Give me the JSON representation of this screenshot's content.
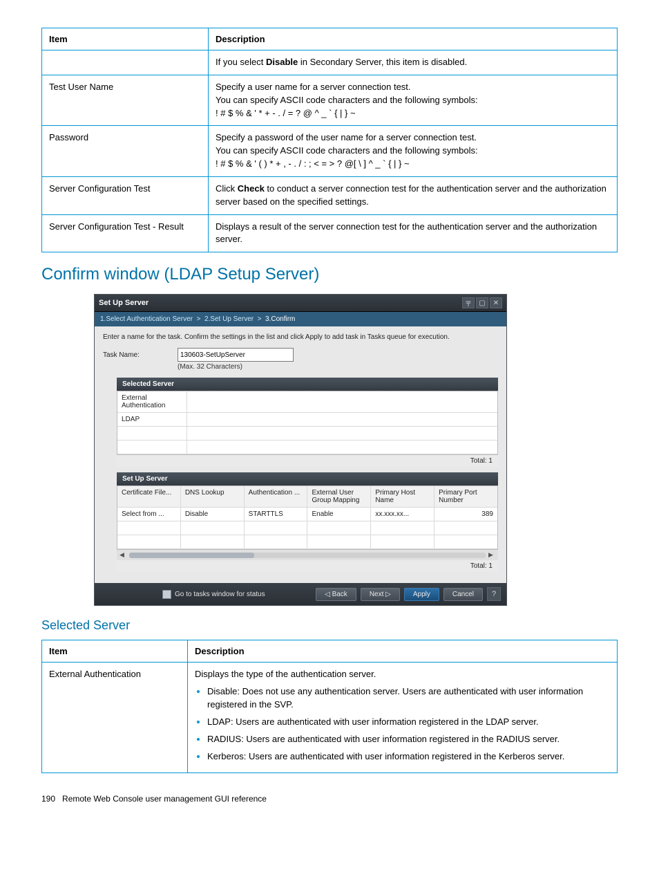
{
  "table1": {
    "headers": [
      "Item",
      "Description"
    ],
    "rows": [
      {
        "item": "",
        "desc_html": "If you select <b>Disable</b> in Secondary Server, this item is disabled."
      },
      {
        "item": "Test User Name",
        "desc_html": "Specify a user name for a server connection test.<br>You can specify ASCII code characters and the following symbols:<br>! # $ % & ' * + - . / = ? @ ^ _ ` { | } ~"
      },
      {
        "item": "Password",
        "desc_html": "Specify a password of the user name for a server connection test.<br>You can specify ASCII code characters and the following symbols:<br>! # $ % & ' ( ) * + , - . / : ; < = > ? @[ \\ ] ^ _ ` { | } ~"
      },
      {
        "item": "Server Configuration Test",
        "desc_html": "Click <b>Check</b> to conduct a server connection test for the authentication server and the authorization server based on the specified settings."
      },
      {
        "item": "Server Configuration Test - Result",
        "desc_html": "Displays a result of the server connection test for the authentication server and the authorization server."
      }
    ]
  },
  "heading_confirm": "Confirm window (LDAP Setup Server)",
  "dialog": {
    "title": "Set Up Server",
    "steps": {
      "s1": "1.Select Authentication Server",
      "s2": "2.Set Up Server",
      "s3": "3.Confirm"
    },
    "instruction": "Enter a name for the task. Confirm the settings in the list and click Apply to add task in Tasks queue for execution.",
    "task_label": "Task Name:",
    "task_value": "130603-SetUpServer",
    "task_hint": "(Max. 32 Characters)",
    "selected_server": {
      "title": "Selected Server",
      "row1": "External Authentication",
      "row2": "LDAP",
      "total": "Total: 1"
    },
    "setup_server": {
      "title": "Set Up Server",
      "headers": [
        "Certificate File...",
        "DNS Lookup",
        "Authentication ...",
        "External User Group Mapping",
        "Primary Host Name",
        "Primary Port Number"
      ],
      "row": [
        "Select from ...",
        "Disable",
        "STARTTLS",
        "Enable",
        "xx.xxx.xx...",
        "389"
      ],
      "total": "Total: 1"
    },
    "footer": {
      "chk": "Go to tasks window for status",
      "back": "◁ Back",
      "next": "Next ▷",
      "apply": "Apply",
      "cancel": "Cancel"
    }
  },
  "heading_selected": "Selected Server",
  "table2": {
    "headers": [
      "Item",
      "Description"
    ],
    "row_item": "External Authentication",
    "row_intro": "Displays the type of the authentication server.",
    "bullets": [
      "Disable: Does not use any authentication server. Users are authenticated with user information registered in the SVP.",
      "LDAP: Users are authenticated with user information registered in the LDAP server.",
      "RADIUS: Users are authenticated with user information registered in the RADIUS server.",
      "Kerberos: Users are authenticated with user information registered in the Kerberos server."
    ]
  },
  "footer": {
    "pagenum": "190",
    "text": "Remote Web Console user management GUI reference"
  }
}
